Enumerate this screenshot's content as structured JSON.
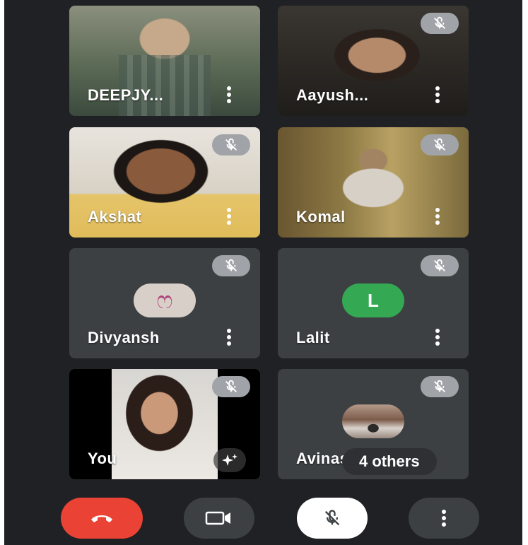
{
  "participants": [
    {
      "name": "DEEPJY...",
      "muted": false,
      "type": "video",
      "bg": "#6b7060"
    },
    {
      "name": "Aayush...",
      "muted": true,
      "type": "video",
      "bg": "#2b2a28"
    },
    {
      "name": "Akshat",
      "muted": true,
      "type": "video",
      "bg": "#d9c9a4"
    },
    {
      "name": "Komal",
      "muted": true,
      "type": "video",
      "bg": "#7a6a3c"
    },
    {
      "name": "Divyansh",
      "muted": true,
      "type": "avatar",
      "avatar_text": "ෆ",
      "avatar_bg": "#d9cfc9",
      "avatar_color": "#b0407a"
    },
    {
      "name": "Lalit",
      "muted": true,
      "type": "avatar",
      "avatar_text": "L",
      "avatar_bg": "#34a853",
      "avatar_color": "#ffffff"
    },
    {
      "name": "You",
      "muted": true,
      "type": "self",
      "bg": "#000000"
    },
    {
      "name": "Avinash",
      "muted": true,
      "type": "photo",
      "avatar_bg": "#8a7c74"
    }
  ],
  "others_label": "4 others",
  "controls": {
    "end_call_color": "#ea4335",
    "camera_bg": "#3c4043",
    "mic_bg": "#ffffff",
    "more_bg": "#3c4043"
  },
  "icons": [
    "mic-off-icon",
    "more-vert-icon",
    "sparkle-effects-icon",
    "end-call-icon",
    "camera-icon"
  ]
}
